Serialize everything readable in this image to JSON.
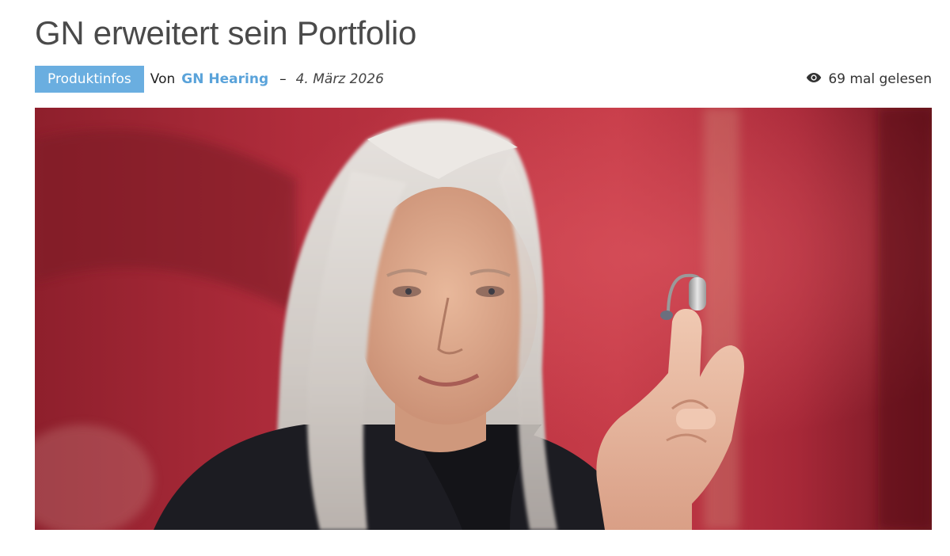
{
  "article": {
    "title": "GN erweitert sein Portfolio",
    "category": "Produktinfos",
    "by_prefix": "Von",
    "author": "GN Hearing",
    "separator": "–",
    "date": "4. März 2026",
    "views_label": "69 mal gelesen",
    "views_icon": "eye-icon"
  },
  "hero_image": {
    "subject": "Frau mit langen grauen Haaren hält ein Hörgerät zwischen Daumen und Zeigefinger vor rotem Hintergrund",
    "accent_color": "#6aaee0",
    "background_color": "#b3283c"
  }
}
